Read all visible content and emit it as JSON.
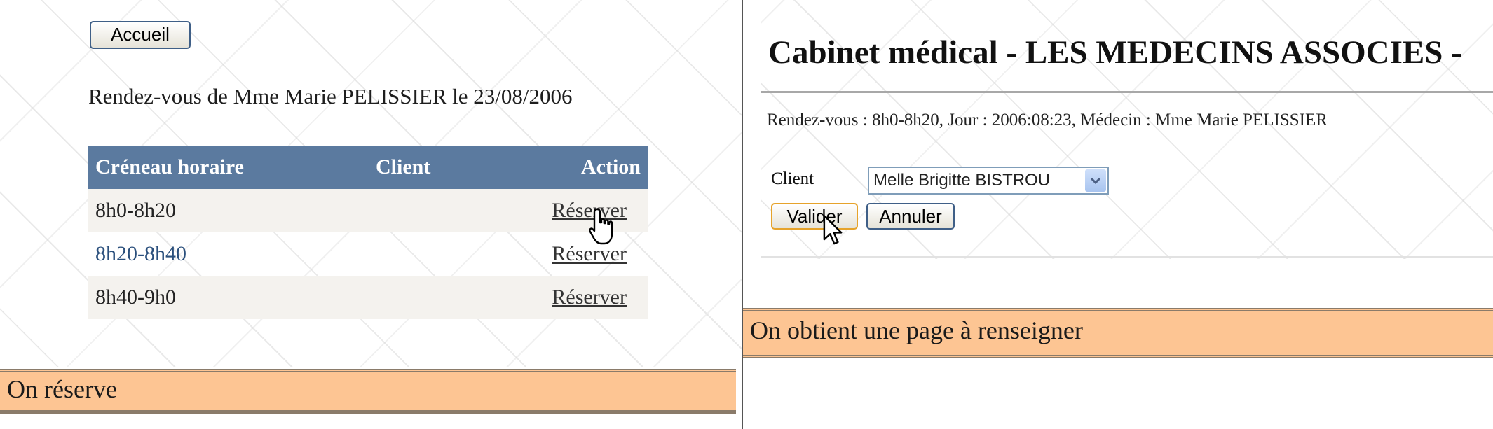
{
  "left": {
    "home_button": "Accueil",
    "title": "Rendez-vous de Mme Marie PELISSIER le 23/08/2006",
    "table": {
      "headers": [
        "Créneau horaire",
        "Client",
        "Action"
      ],
      "rows": [
        {
          "slot": "8h0-8h20",
          "client": "",
          "action": "Réserver"
        },
        {
          "slot": "8h20-8h40",
          "client": "",
          "action": "Réserver"
        },
        {
          "slot": "8h40-9h0",
          "client": "",
          "action": "Réserver"
        }
      ]
    },
    "caption": "On réserve"
  },
  "right": {
    "title": "Cabinet médical - LES MEDECINS ASSOCIES -",
    "appointment_info": "Rendez-vous : 8h0-8h20, Jour : 2006:08:23, Médecin : Mme Marie PELISSIER",
    "client_label": "Client",
    "client_selected": "Melle Brigitte BISTROU",
    "validate_button": "Valider",
    "cancel_button": "Annuler",
    "caption": "On obtient une page à renseigner"
  },
  "colors": {
    "caption_bg": "#fdc593",
    "table_header_bg": "#5b7a9f",
    "link_color": "#2a4f7c"
  },
  "icons": {
    "hand_cursor": "hand-pointer-cursor-icon",
    "arrow_cursor": "arrow-pointer-cursor-icon",
    "dropdown": "chevron-down-icon"
  }
}
